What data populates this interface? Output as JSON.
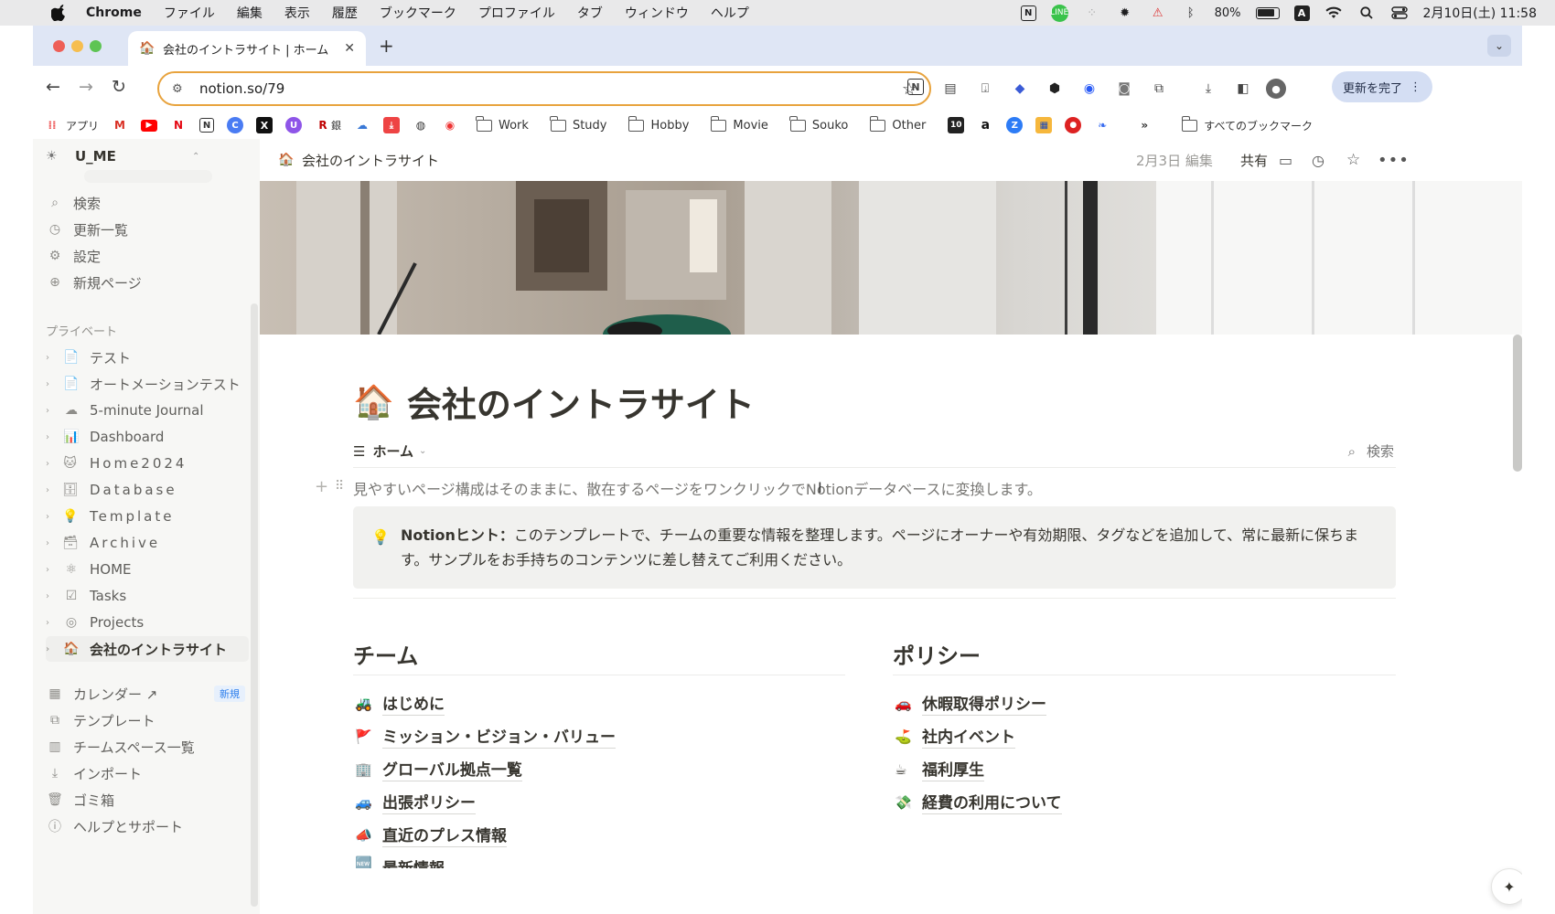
{
  "menubar": {
    "app": "Chrome",
    "items": [
      "ファイル",
      "編集",
      "表示",
      "履歴",
      "ブックマーク",
      "プロファイル",
      "タブ",
      "ウィンドウ",
      "ヘルプ"
    ],
    "battery": "80%",
    "datetime": "2月10日(土) 11:58"
  },
  "tab": {
    "title": "会社のイントラサイト | ホーム",
    "favicon": "🏠"
  },
  "toolbar": {
    "url": "notion.so/79",
    "update_label": "更新を完了"
  },
  "bookmarks": {
    "apps": "アプリ",
    "ginko": "銀",
    "folders": [
      "Work",
      "Study",
      "Hobby",
      "Movie",
      "Souko",
      "Other"
    ],
    "all": "すべてのブックマーク"
  },
  "sidebar": {
    "workspace": "U_ME",
    "top": [
      {
        "icon": "search-icon",
        "label": "検索"
      },
      {
        "icon": "clock-icon",
        "label": "更新一覧"
      },
      {
        "icon": "gear-icon",
        "label": "設定"
      },
      {
        "icon": "plus-circle-icon",
        "label": "新規ページ"
      }
    ],
    "private_header": "プライベート",
    "pages": [
      {
        "emoji": "📄",
        "label": "テスト"
      },
      {
        "emoji": "📄",
        "label": "オートメーションテスト"
      },
      {
        "emoji": "☁",
        "label": "5-minute Journal"
      },
      {
        "emoji": "📊",
        "label": "Dashboard"
      },
      {
        "emoji": "🐱",
        "label": "Home2024"
      },
      {
        "emoji": "🗄",
        "label": "Database"
      },
      {
        "emoji": "💡",
        "label": "Template"
      },
      {
        "emoji": "🗃",
        "label": "Archive"
      },
      {
        "emoji": "⚛",
        "label": "HOME"
      },
      {
        "emoji": "☑",
        "label": "Tasks"
      },
      {
        "emoji": "◎",
        "label": "Projects"
      },
      {
        "emoji": "🏠",
        "label": "会社のイントラサイト"
      }
    ],
    "bottom": [
      {
        "icon": "calendar-icon",
        "label": "カレンダー ↗",
        "badge": "新規"
      },
      {
        "icon": "template-icon",
        "label": "テンプレート"
      },
      {
        "icon": "building-icon",
        "label": "チームスペース一覧"
      },
      {
        "icon": "import-icon",
        "label": "インポート"
      },
      {
        "icon": "trash-icon",
        "label": "ゴミ箱"
      },
      {
        "icon": "help-icon",
        "label": "ヘルプとサポート"
      }
    ]
  },
  "page": {
    "breadcrumb": "会社のイントラサイト",
    "edited": "2月3日 編集",
    "share": "共有",
    "title": "会社のイントラサイト",
    "title_emoji": "🏠",
    "view_label": "ホーム",
    "search_label": "検索",
    "description": "見やすいページ構成はそのままに、散在するページをワンクリックでNotionデータベースに変換します。",
    "callout_bold": "Notionヒント：",
    "callout_text": "このテンプレートで、チームの重要な情報を整理します。ページにオーナーや有効期限、タグなどを追加して、常に最新に保ちます。サンプルをお手持ちのコンテンツに差し替えてご利用ください。",
    "team_heading": "チーム",
    "team_links": [
      {
        "emoji": "🚜",
        "label": "はじめに"
      },
      {
        "emoji": "🚩",
        "label": "ミッション・ビジョン・バリュー"
      },
      {
        "emoji": "🏢",
        "label": "グローバル拠点一覧"
      },
      {
        "emoji": "🚙",
        "label": "出張ポリシー"
      },
      {
        "emoji": "📣",
        "label": "直近のプレス情報"
      },
      {
        "emoji": "🆕",
        "label": "最新情報"
      }
    ],
    "policy_heading": "ポリシー",
    "policy_links": [
      {
        "emoji": "🚗",
        "label": "休暇取得ポリシー"
      },
      {
        "emoji": "⛳",
        "label": "社内イベント"
      },
      {
        "emoji": "☕",
        "label": "福利厚生"
      },
      {
        "emoji": "💸",
        "label": "経費の利用について"
      }
    ]
  }
}
